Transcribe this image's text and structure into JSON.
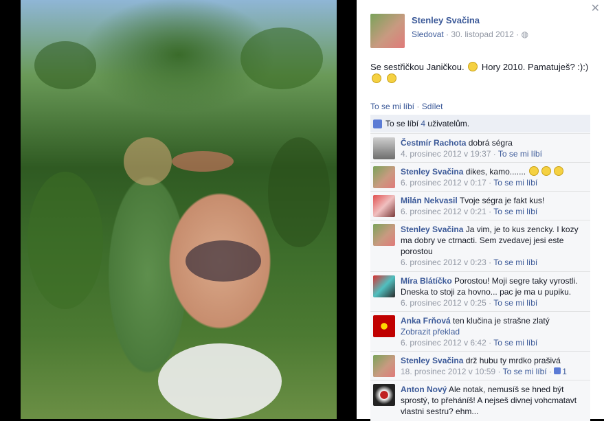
{
  "header": {
    "author": "Stenley Svačina",
    "follow": "Sledovat",
    "date": "· 30. listopad 2012 ·",
    "privacy_icon": "globe-icon"
  },
  "post": {
    "text_line1": "Se sestřičkou Janičkou.",
    "text_line1b": "Hory 2010. Pamatuješ? :):)"
  },
  "actions": {
    "like": "To se mi líbí",
    "share": "Sdílet"
  },
  "likes": {
    "prefix": "To se líbí",
    "count": "4",
    "suffix": "uživatelům."
  },
  "comments": [
    {
      "author": "Čestmír Rachota",
      "text": "dobrá ségra",
      "time": "4. prosinec 2012 v 19:37",
      "like": "To se mi líbí"
    },
    {
      "author": "Stenley Svačina",
      "text": "dikes, kamo.......",
      "time": "6. prosinec 2012 v 0:17",
      "like": "To se mi líbí"
    },
    {
      "author": "Milán Nekvasil",
      "text": "Tvoje ségra je fakt kus!",
      "time": "6. prosinec 2012 v 0:21",
      "like": "To se mi líbí"
    },
    {
      "author": "Stenley Svačina",
      "text": "Ja vim, je to kus zencky. I kozy ma dobry ve ctrnacti. Sem zvedavej jesi este porostou",
      "time": "6. prosinec 2012 v 0:23",
      "like": "To se mi líbí"
    },
    {
      "author": "Míra Blátíčko",
      "text": "Porostou! Moji segre taky vyrostli. Dneska to stoji za hovno... pac je ma u pupiku.",
      "time": "6. prosinec 2012 v 0:25",
      "like": "To se mi líbí"
    },
    {
      "author": "Anka Frňová",
      "text": "ten klučina je strašne zlatý",
      "translate": "Zobrazit překlad",
      "time": "6. prosinec 2012 v 6:42",
      "like": "To se mi líbí"
    },
    {
      "author": "Stenley Svačina",
      "text": "drž hubu ty mrdko prašivá",
      "time": "18. prosinec 2012 v 10:59",
      "like": "To se mi líbí",
      "like_count": "1"
    },
    {
      "author": "Anton Nový",
      "text": "Ale notak, nemusíš se hned být sprostý, to přeháníš! A nejseš divnej vohcmatavt vlastni sestru? ehm..."
    }
  ],
  "colors": {
    "link": "#3b5998",
    "meta": "#9197a3",
    "comment_bg": "#f6f7f9"
  }
}
